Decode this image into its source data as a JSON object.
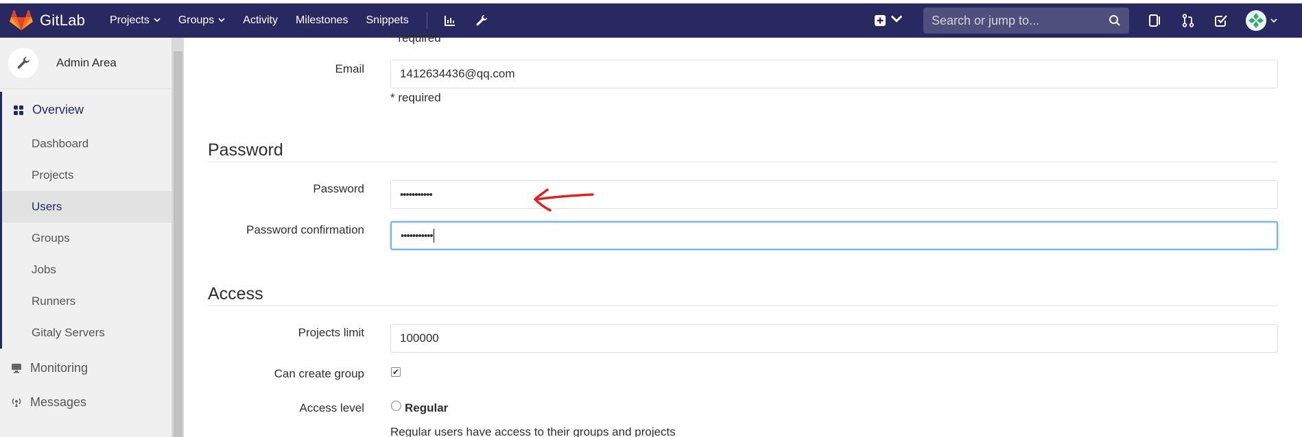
{
  "topbar": {
    "brand": "GitLab",
    "nav": [
      {
        "label": "Projects",
        "caret": true
      },
      {
        "label": "Groups",
        "caret": true
      },
      {
        "label": "Activity",
        "caret": false
      },
      {
        "label": "Milestones",
        "caret": false
      },
      {
        "label": "Snippets",
        "caret": false
      }
    ],
    "search_placeholder": "Search or jump to...",
    "icons": [
      "chart-icon",
      "wrench-icon",
      "plus-square-icon",
      "search-icon",
      "issues-icon",
      "merge-request-icon",
      "todo-icon",
      "avatar"
    ]
  },
  "sidebar": {
    "header": "Admin Area",
    "overview": "Overview",
    "items": [
      {
        "label": "Dashboard",
        "active": false
      },
      {
        "label": "Projects",
        "active": false
      },
      {
        "label": "Users",
        "active": true
      },
      {
        "label": "Groups",
        "active": false
      },
      {
        "label": "Jobs",
        "active": false
      },
      {
        "label": "Runners",
        "active": false
      },
      {
        "label": "Gitaly Servers",
        "active": false
      }
    ],
    "sections": [
      "Monitoring",
      "Messages"
    ]
  },
  "form": {
    "cut_help": "* required",
    "email": {
      "label": "Email",
      "value": "1412634436@qq.com",
      "help": "* required"
    },
    "password_section": "Password",
    "password": {
      "label": "Password",
      "value": "•••••••••••"
    },
    "password_confirmation": {
      "label": "Password confirmation",
      "value": "•••••••••••"
    },
    "access_section": "Access",
    "projects_limit": {
      "label": "Projects limit",
      "value": "100000"
    },
    "can_create_group": {
      "label": "Can create group",
      "checked": true,
      "mark": "✔"
    },
    "access_level": {
      "label": "Access level",
      "option": "Regular",
      "help": "Regular users have access to their groups and projects"
    }
  },
  "colors": {
    "nav_bg": "#292961",
    "accent": "#292961",
    "annotation_arrow": "#e02020",
    "focus_border": "#73afea"
  }
}
